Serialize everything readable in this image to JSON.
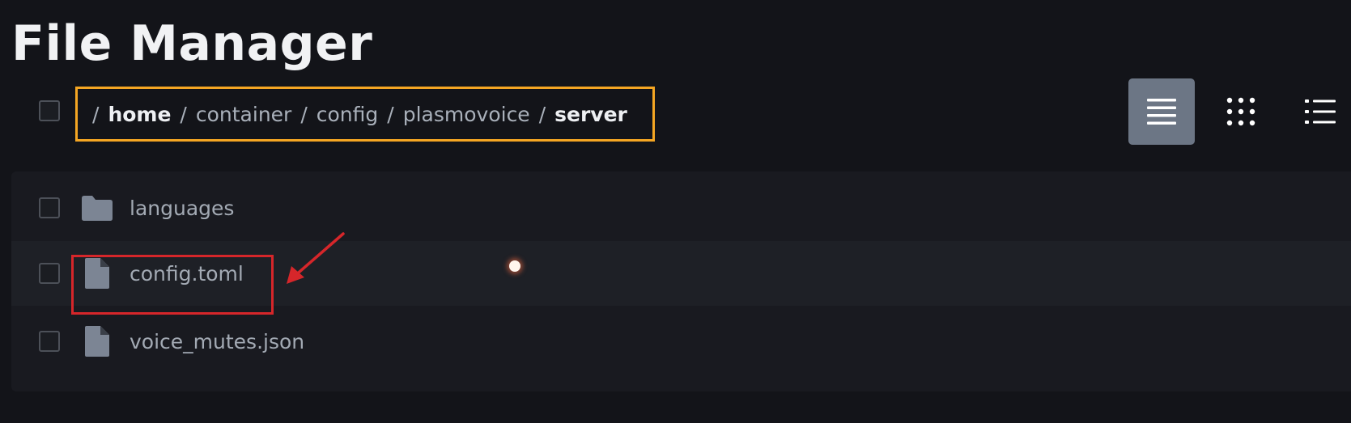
{
  "page": {
    "title": "File Manager"
  },
  "breadcrumb": {
    "separator": "/",
    "segments": [
      {
        "label": "home",
        "strong": true
      },
      {
        "label": "container",
        "strong": false
      },
      {
        "label": "config",
        "strong": false
      },
      {
        "label": "plasmovoice",
        "strong": false
      },
      {
        "label": "server",
        "strong": true
      }
    ]
  },
  "view_modes": [
    {
      "icon": "list-view-icon",
      "active": true
    },
    {
      "icon": "grid-view-icon",
      "active": false
    },
    {
      "icon": "bullet-list-view-icon",
      "active": false
    }
  ],
  "files": [
    {
      "name": "languages",
      "type": "folder",
      "icon": "folder-icon"
    },
    {
      "name": "config.toml",
      "type": "file",
      "icon": "file-icon"
    },
    {
      "name": "voice_mutes.json",
      "type": "file",
      "icon": "file-icon"
    }
  ],
  "colors": {
    "background": "#131419",
    "panel": "#191a20",
    "breadcrumb_highlight": "#f5a623",
    "annotation_red": "#d6262a",
    "active_view_button": "#6c7685"
  }
}
